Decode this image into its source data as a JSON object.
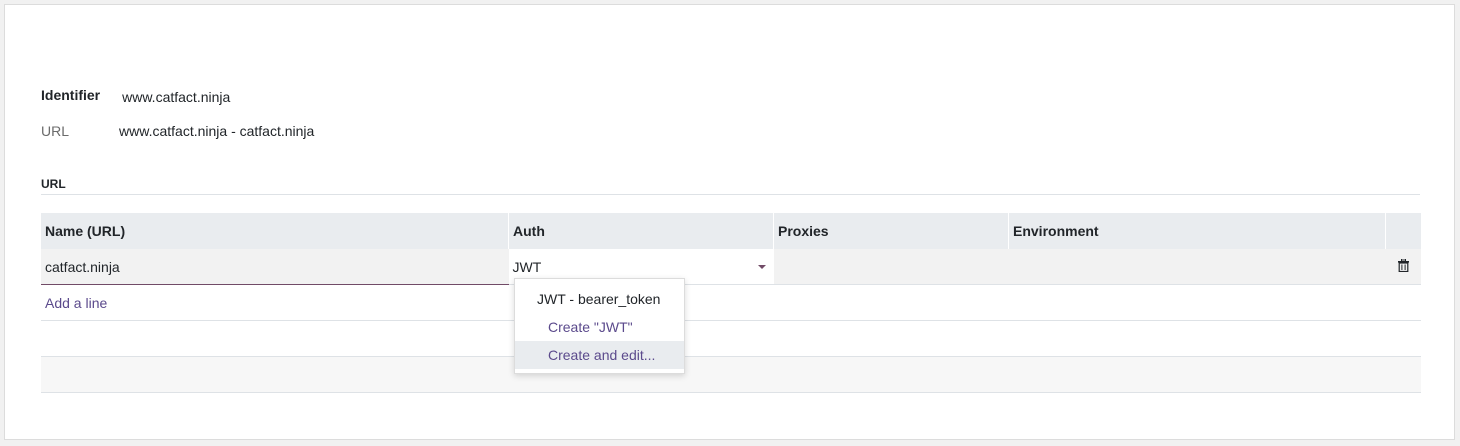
{
  "fields": {
    "identifier_label": "Identifier",
    "identifier_value": "www.catfact.ninja",
    "url_label": "URL",
    "url_value": "www.catfact.ninja - catfact.ninja"
  },
  "section": {
    "title": "URL"
  },
  "table": {
    "headers": [
      "Name (URL)",
      "Auth",
      "Proxies",
      "Environment"
    ],
    "row": {
      "name": "catfact.ninja",
      "auth": "JWT",
      "proxies": "",
      "environment": ""
    },
    "add_line": "Add a line"
  },
  "dropdown": {
    "items": [
      "JWT - bearer_token",
      "Create \"JWT\"",
      "Create and edit..."
    ]
  },
  "icons": {
    "delete": "trash-icon",
    "toggle": "caret-down-icon"
  },
  "colors": {
    "accent": "#714b67",
    "link": "#5b4a8c",
    "header_bg": "#e9ecef"
  }
}
